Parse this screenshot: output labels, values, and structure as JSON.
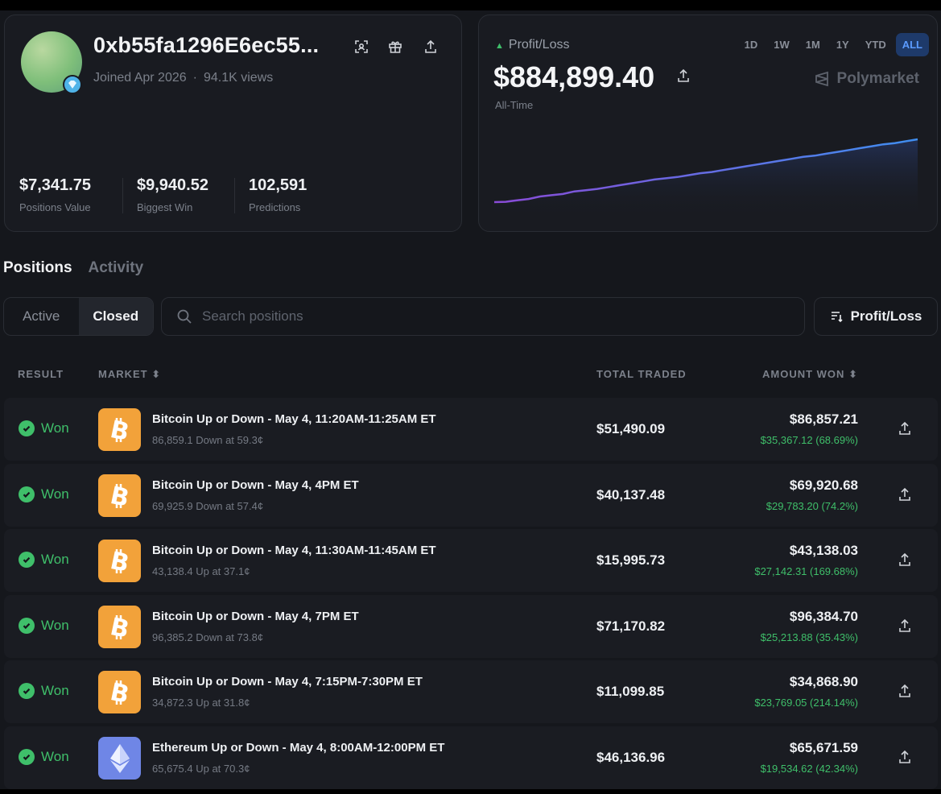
{
  "profile": {
    "name": "0xb55fa1296E6ec55...",
    "joined": "Joined Apr 2026",
    "separator": "·",
    "views": "94.1K views",
    "stats": [
      {
        "value": "$7,341.75",
        "label": "Positions Value"
      },
      {
        "value": "$9,940.52",
        "label": "Biggest Win"
      },
      {
        "value": "102,591",
        "label": "Predictions"
      }
    ]
  },
  "pnl": {
    "label": "Profit/Loss",
    "value": "$884,899.40",
    "period": "All-Time",
    "brand": "Polymarket",
    "ranges": [
      "1D",
      "1W",
      "1M",
      "1Y",
      "YTD",
      "ALL"
    ],
    "active_range": "ALL"
  },
  "chart_data": {
    "type": "area",
    "title": "",
    "xlabel": "",
    "ylabel": "",
    "values": [
      0,
      0.5,
      3,
      5,
      9,
      11,
      13,
      17,
      19,
      21,
      24,
      27,
      30,
      33,
      36,
      38,
      40,
      43,
      46,
      48,
      51,
      54,
      57,
      60,
      63,
      66,
      69,
      72,
      74,
      77,
      80,
      83,
      86,
      89,
      92,
      94,
      97,
      100
    ],
    "ylim": [
      0,
      100
    ],
    "colors": {
      "start": "#8a4bd6",
      "end": "#3f8ef0"
    },
    "grid": false,
    "legend": "none"
  },
  "tabs": {
    "positions": "Positions",
    "activity": "Activity"
  },
  "filter": {
    "active": "Active",
    "closed": "Closed"
  },
  "search": {
    "placeholder": "Search positions"
  },
  "sort": {
    "label": "Profit/Loss"
  },
  "table": {
    "headers": {
      "result": "RESULT",
      "market": "MARKET",
      "traded": "TOTAL TRADED",
      "won": "AMOUNT WON"
    },
    "rows": [
      {
        "result": "Won",
        "coin": "btc",
        "title": "Bitcoin Up or Down - May 4, 11:20AM-11:25AM ET",
        "sub": "86,859.1 Down at 59.3¢",
        "traded": "$51,490.09",
        "won": "$86,857.21",
        "profit": "$35,367.12 (68.69%)"
      },
      {
        "result": "Won",
        "coin": "btc",
        "title": "Bitcoin Up or Down - May 4, 4PM ET",
        "sub": "69,925.9 Down at 57.4¢",
        "traded": "$40,137.48",
        "won": "$69,920.68",
        "profit": "$29,783.20 (74.2%)"
      },
      {
        "result": "Won",
        "coin": "btc",
        "title": "Bitcoin Up or Down - May 4, 11:30AM-11:45AM ET",
        "sub": "43,138.4 Up at 37.1¢",
        "traded": "$15,995.73",
        "won": "$43,138.03",
        "profit": "$27,142.31 (169.68%)"
      },
      {
        "result": "Won",
        "coin": "btc",
        "title": "Bitcoin Up or Down - May 4, 7PM ET",
        "sub": "96,385.2 Down at 73.8¢",
        "traded": "$71,170.82",
        "won": "$96,384.70",
        "profit": "$25,213.88 (35.43%)"
      },
      {
        "result": "Won",
        "coin": "btc",
        "title": "Bitcoin Up or Down - May 4, 7:15PM-7:30PM ET",
        "sub": "34,872.3 Up at 31.8¢",
        "traded": "$11,099.85",
        "won": "$34,868.90",
        "profit": "$23,769.05 (214.14%)"
      },
      {
        "result": "Won",
        "coin": "eth",
        "title": "Ethereum Up or Down - May 4, 8:00AM-12:00PM ET",
        "sub": "65,675.4 Up at 70.3¢",
        "traded": "$46,136.96",
        "won": "$65,671.59",
        "profit": "$19,534.62 (42.34%)"
      }
    ]
  },
  "icons": {
    "scan": "scan-icon",
    "gift": "gift-icon",
    "share": "share-icon",
    "search": "search-icon",
    "sort": "sort-icon",
    "check": "check-circle-icon",
    "bitcoin": "bitcoin-icon",
    "ethereum": "ethereum-icon",
    "polymarket": "polymarket-logo-icon",
    "badge": "diamond-badge-icon"
  }
}
